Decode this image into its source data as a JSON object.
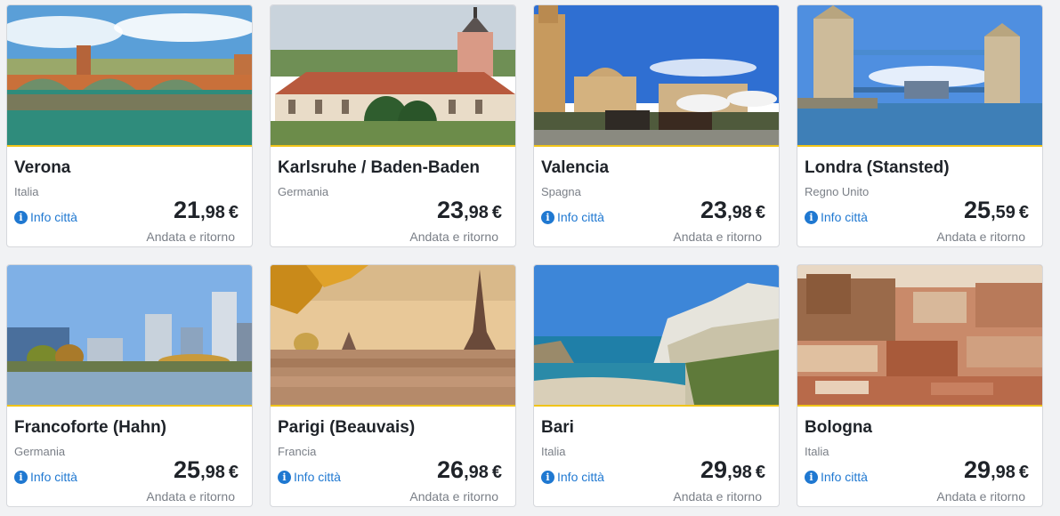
{
  "destinations": [
    {
      "city": "Verona",
      "country": "Italia",
      "info": "Info città",
      "price_int": "21",
      "price_dec": ",98",
      "currency": "€",
      "trip": "Andata e ritorno"
    },
    {
      "city": "Karlsruhe / Baden-Baden",
      "country": "Germania",
      "info": "",
      "price_int": "23",
      "price_dec": ",98",
      "currency": "€",
      "trip": "Andata e ritorno"
    },
    {
      "city": "Valencia",
      "country": "Spagna",
      "info": "Info città",
      "price_int": "23",
      "price_dec": ",98",
      "currency": "€",
      "trip": "Andata e ritorno"
    },
    {
      "city": "Londra (Stansted)",
      "country": "Regno Unito",
      "info": "Info città",
      "price_int": "25",
      "price_dec": ",59",
      "currency": "€",
      "trip": "Andata e ritorno"
    },
    {
      "city": "Francoforte (Hahn)",
      "country": "Germania",
      "info": "Info città",
      "price_int": "25",
      "price_dec": ",98",
      "currency": "€",
      "trip": "Andata e ritorno"
    },
    {
      "city": "Parigi (Beauvais)",
      "country": "Francia",
      "info": "Info città",
      "price_int": "26",
      "price_dec": ",98",
      "currency": "€",
      "trip": "Andata e ritorno"
    },
    {
      "city": "Bari",
      "country": "Italia",
      "info": "Info città",
      "price_int": "29",
      "price_dec": ",98",
      "currency": "€",
      "trip": "Andata e ritorno"
    },
    {
      "city": "Bologna",
      "country": "Italia",
      "info": "Info città",
      "price_int": "29",
      "price_dec": ",98",
      "currency": "€",
      "trip": "Andata e ritorno"
    }
  ],
  "colors": {
    "accent": "#f0c419",
    "link": "#1f78d1"
  },
  "icons": {
    "info": "info-icon"
  }
}
